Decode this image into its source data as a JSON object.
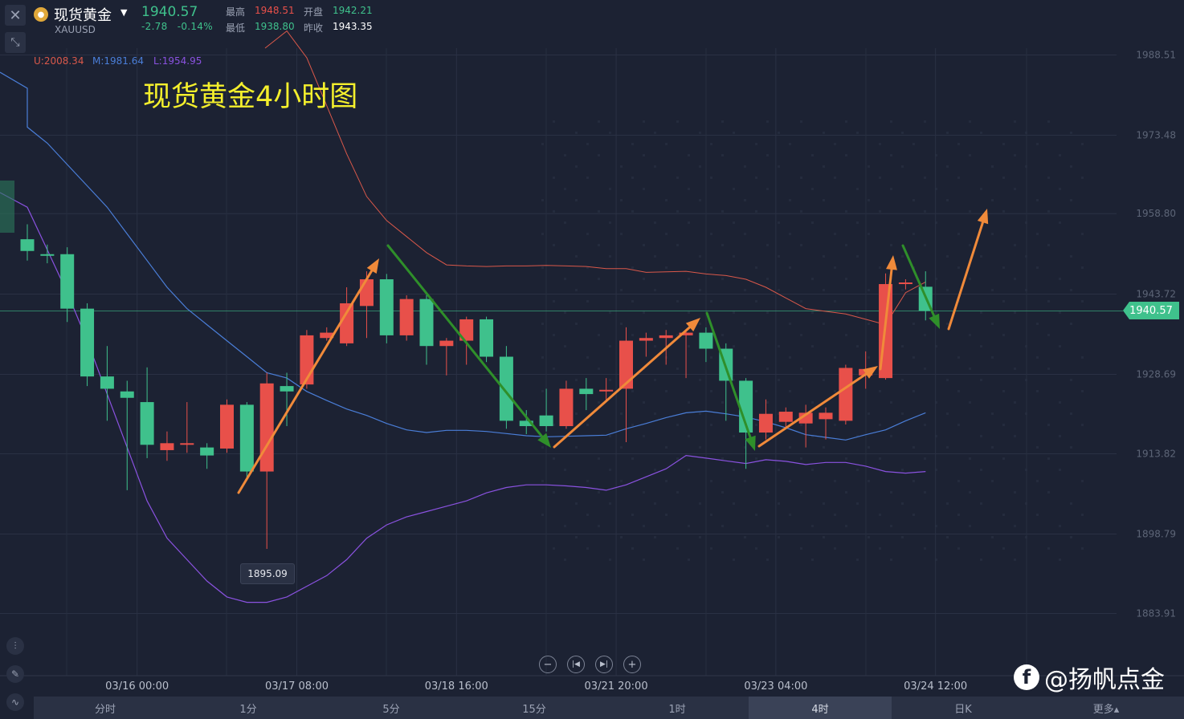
{
  "header": {
    "name": "现货黄金",
    "code": "XAUUSD",
    "price": "1940.57",
    "change": "-2.78",
    "change_pct": "-0.14%",
    "high_label": "最高",
    "high_value": "1948.51",
    "low_label": "最低",
    "low_value": "1938.80",
    "open_label": "开盘",
    "open_value": "1942.21",
    "prev_close_label": "昨收",
    "prev_close_value": "1943.35"
  },
  "indicator": {
    "upper": "U:2008.34",
    "middle": "M:1981.64",
    "lower": "L:1954.95"
  },
  "chart_title": "现货黄金4小时图",
  "current_price_tag": "1940.57",
  "low_marker": "1895.09",
  "colors": {
    "up": "#e8504a",
    "down": "#3fc18c",
    "boll_upper": "#d9584a",
    "boll_middle": "#4a7ed8",
    "boll_lower": "#8a52e0",
    "arrow_up": "#f08a3a",
    "arrow_down": "#2f8f2a",
    "title": "#f4ef2c"
  },
  "chart_data": {
    "type": "candlestick",
    "symbol": "XAUUSD",
    "timeframe": "4小时",
    "y_ticks": [
      1988.51,
      1973.48,
      1958.8,
      1943.72,
      1928.69,
      1913.82,
      1898.79,
      1883.91
    ],
    "y_tick_labels": [
      "1988.51",
      "1973.48",
      "1958.80",
      "1943.72",
      "1928.69",
      "1913.82",
      "1898.79",
      "1883.91"
    ],
    "ylim": [
      1875,
      1995
    ],
    "x_tick_labels": [
      "03/16 00:00",
      "03/17 08:00",
      "03/18 16:00",
      "03/21 20:00",
      "03/23 04:00",
      "03/24 12:00"
    ],
    "x_tick_index": [
      6,
      14,
      22,
      30,
      38,
      46
    ],
    "candles": [
      {
        "o": 1954.0,
        "c": 1951.8,
        "h": 1956.8,
        "l": 1950.0
      },
      {
        "o": 1951.2,
        "c": 1951.0,
        "h": 1953.0,
        "l": 1949.5
      },
      {
        "o": 1951.2,
        "c": 1941.0,
        "h": 1952.5,
        "l": 1938.5
      },
      {
        "o": 1941.0,
        "c": 1928.3,
        "h": 1942.0,
        "l": 1926.5
      },
      {
        "o": 1928.3,
        "c": 1926.0,
        "h": 1934.0,
        "l": 1920.0
      },
      {
        "o": 1925.5,
        "c": 1924.3,
        "h": 1927.5,
        "l": 1907.0
      },
      {
        "o": 1923.5,
        "c": 1915.5,
        "h": 1930.0,
        "l": 1913.0
      },
      {
        "o": 1914.5,
        "c": 1915.8,
        "h": 1918.0,
        "l": 1912.5
      },
      {
        "o": 1915.5,
        "c": 1915.8,
        "h": 1923.5,
        "l": 1914.0
      },
      {
        "o": 1915.0,
        "c": 1913.5,
        "h": 1915.8,
        "l": 1911.0
      },
      {
        "o": 1914.8,
        "c": 1923.0,
        "h": 1924.0,
        "l": 1914.0
      },
      {
        "o": 1923.0,
        "c": 1910.5,
        "h": 1923.5,
        "l": 1909.0
      },
      {
        "o": 1910.5,
        "c": 1927.0,
        "h": 1929.0,
        "l": 1896.0
      },
      {
        "o": 1926.5,
        "c": 1925.5,
        "h": 1929.0,
        "l": 1919.0
      },
      {
        "o": 1926.8,
        "c": 1936.0,
        "h": 1937.0,
        "l": 1926.0
      },
      {
        "o": 1935.5,
        "c": 1936.5,
        "h": 1937.5,
        "l": 1935.0
      },
      {
        "o": 1934.5,
        "c": 1942.0,
        "h": 1945.0,
        "l": 1934.0
      },
      {
        "o": 1941.5,
        "c": 1946.5,
        "h": 1948.0,
        "l": 1935.5
      },
      {
        "o": 1946.5,
        "c": 1936.0,
        "h": 1947.5,
        "l": 1934.5
      },
      {
        "o": 1936.0,
        "c": 1942.8,
        "h": 1943.5,
        "l": 1935.0
      },
      {
        "o": 1942.8,
        "c": 1934.0,
        "h": 1944.0,
        "l": 1930.5
      },
      {
        "o": 1934.0,
        "c": 1935.0,
        "h": 1935.5,
        "l": 1928.5
      },
      {
        "o": 1935.0,
        "c": 1939.0,
        "h": 1939.5,
        "l": 1930.5
      },
      {
        "o": 1939.0,
        "c": 1932.0,
        "h": 1939.5,
        "l": 1931.0
      },
      {
        "o": 1932.0,
        "c": 1920.0,
        "h": 1934.0,
        "l": 1918.5
      },
      {
        "o": 1920.0,
        "c": 1919.0,
        "h": 1922.0,
        "l": 1917.5
      },
      {
        "o": 1921.0,
        "c": 1919.0,
        "h": 1926.0,
        "l": 1918.0
      },
      {
        "o": 1919.0,
        "c": 1926.0,
        "h": 1927.5,
        "l": 1918.5
      },
      {
        "o": 1926.0,
        "c": 1925.0,
        "h": 1928.0,
        "l": 1922.0
      },
      {
        "o": 1925.5,
        "c": 1925.8,
        "h": 1928.0,
        "l": 1923.5
      },
      {
        "o": 1926.0,
        "c": 1935.0,
        "h": 1937.5,
        "l": 1916.0
      },
      {
        "o": 1935.0,
        "c": 1935.5,
        "h": 1936.5,
        "l": 1932.0
      },
      {
        "o": 1935.5,
        "c": 1936.0,
        "h": 1937.0,
        "l": 1930.5
      },
      {
        "o": 1936.0,
        "c": 1936.5,
        "h": 1936.8,
        "l": 1928.0
      },
      {
        "o": 1936.5,
        "c": 1933.5,
        "h": 1937.5,
        "l": 1931.0
      },
      {
        "o": 1933.5,
        "c": 1927.5,
        "h": 1934.5,
        "l": 1920.0
      },
      {
        "o": 1927.5,
        "c": 1917.8,
        "h": 1928.0,
        "l": 1911.0
      },
      {
        "o": 1917.8,
        "c": 1921.3,
        "h": 1924.0,
        "l": 1916.5
      },
      {
        "o": 1919.8,
        "c": 1921.7,
        "h": 1922.5,
        "l": 1918.5
      },
      {
        "o": 1919.5,
        "c": 1921.5,
        "h": 1923.0,
        "l": 1915.0
      },
      {
        "o": 1920.3,
        "c": 1921.5,
        "h": 1922.5,
        "l": 1916.5
      },
      {
        "o": 1920.0,
        "c": 1929.9,
        "h": 1930.5,
        "l": 1919.3
      },
      {
        "o": 1928.5,
        "c": 1929.7,
        "h": 1933.0,
        "l": 1926.0
      },
      {
        "o": 1928.0,
        "c": 1945.6,
        "h": 1947.6,
        "l": 1927.7
      },
      {
        "o": 1945.6,
        "c": 1945.9,
        "h": 1946.5,
        "l": 1944.6
      },
      {
        "o": 1945.1,
        "c": 1940.6,
        "h": 1948.0,
        "l": 1938.8
      }
    ],
    "boll_upper": [
      null,
      null,
      null,
      null,
      null,
      null,
      null,
      null,
      null,
      null,
      null,
      null,
      null,
      1993.0,
      1988.0,
      1979.0,
      1970.0,
      1962.0,
      1957.5,
      1954.5,
      1951.5,
      1949.2,
      1949.0,
      1948.9,
      1949.0,
      1949.0,
      1949.1,
      1949.0,
      1948.9,
      1948.5,
      1948.5,
      1947.8,
      1947.9,
      1948.0,
      1947.5,
      1947.2,
      1946.5,
      1945.0,
      1943.0,
      1941.0,
      1940.5,
      1940.0,
      1939.0,
      1938.0,
      1944.0,
      1946.0
    ],
    "boll_middle": [
      1975.0,
      1972.0,
      1968.0,
      1964.0,
      1960.0,
      1955.0,
      1950.0,
      1945.0,
      1941.0,
      1938.0,
      1935.0,
      1932.0,
      1929.0,
      1928.0,
      1925.5,
      1923.8,
      1922.2,
      1921.0,
      1919.5,
      1918.3,
      1917.8,
      1918.2,
      1918.2,
      1918.0,
      1917.6,
      1917.2,
      1917.0,
      1917.1,
      1917.2,
      1917.3,
      1918.5,
      1919.5,
      1920.6,
      1921.5,
      1921.8,
      1921.3,
      1920.7,
      1919.8,
      1918.7,
      1917.4,
      1916.9,
      1916.4,
      1917.4,
      1918.3,
      1920.0,
      1921.5
    ],
    "boll_lower": [
      1960.0,
      1952.0,
      1944.0,
      1935.0,
      1925.0,
      1915.0,
      1905.0,
      1898.0,
      1894.0,
      1890.0,
      1887.0,
      1886.0,
      1886.0,
      1887.0,
      1889.0,
      1891.0,
      1894.0,
      1898.0,
      1900.5,
      1902.0,
      1903.0,
      1904.0,
      1905.0,
      1906.5,
      1907.5,
      1908.0,
      1908.0,
      1907.8,
      1907.5,
      1907.0,
      1908.0,
      1909.5,
      1911.0,
      1913.5,
      1913.0,
      1912.5,
      1912.0,
      1912.7,
      1912.4,
      1911.8,
      1912.2,
      1912.2,
      1911.5,
      1910.5,
      1910.2,
      1910.5
    ]
  },
  "controls": {
    "zoom_out": "−",
    "rewind": "|◀",
    "forward": "▶|",
    "zoom_in": "+"
  },
  "tabs": [
    {
      "label": "分时",
      "active": false
    },
    {
      "label": "1分",
      "active": false
    },
    {
      "label": "5分",
      "active": false
    },
    {
      "label": "15分",
      "active": false
    },
    {
      "label": "1时",
      "active": false
    },
    {
      "label": "4时",
      "active": true
    },
    {
      "label": "日K",
      "active": false
    },
    {
      "label": "更多▴",
      "active": false
    }
  ],
  "watermark": {
    "icon_letter": "f",
    "text": "@扬帆点金"
  },
  "icons": {
    "close": "close-icon",
    "collapse": "collapse-icon",
    "coin": "gold-coin-icon",
    "tools": [
      "indicator-icon",
      "draw-pencil-icon",
      "trend-line-icon"
    ]
  }
}
